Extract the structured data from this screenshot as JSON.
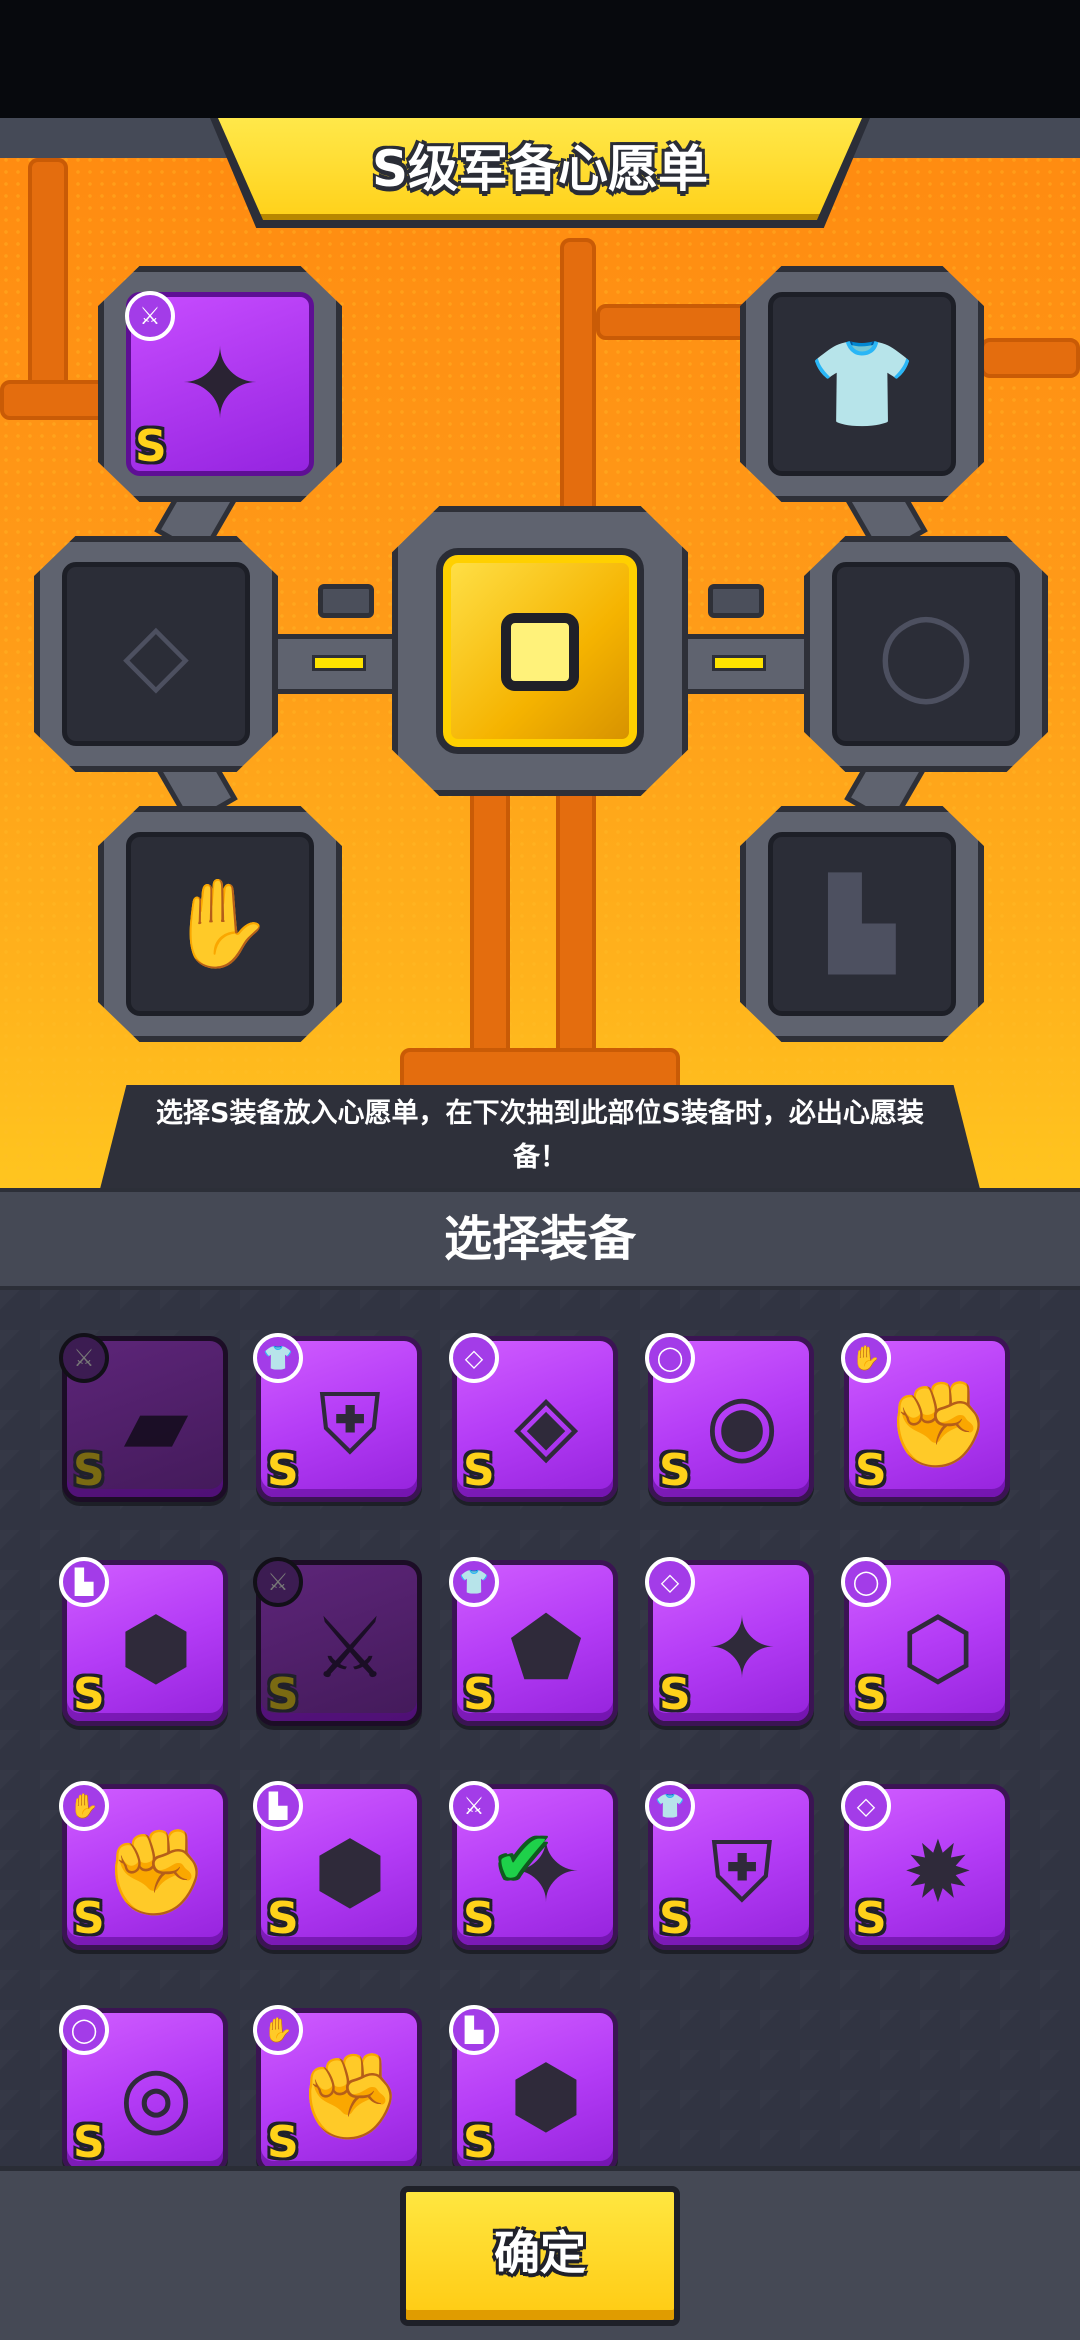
{
  "wishlist": {
    "title": "S级军备心愿单",
    "slots": [
      {
        "slot": "weapon",
        "icon": "dagger-icon",
        "state": "filled",
        "grade": "S"
      },
      {
        "slot": "armor",
        "icon": "shirt-icon",
        "state": "empty"
      },
      {
        "slot": "necklace",
        "icon": "necklace-icon",
        "state": "empty"
      },
      {
        "slot": "belt",
        "icon": "belt-icon",
        "state": "empty"
      },
      {
        "slot": "gloves",
        "icon": "glove-icon",
        "state": "empty"
      },
      {
        "slot": "boots",
        "icon": "boot-icon",
        "state": "empty"
      }
    ],
    "hint": "选择S装备放入心愿单，在下次抽到此部位S装备时，必出心愿装备！"
  },
  "selection": {
    "title": "选择装备",
    "items": [
      {
        "slot": "weapon",
        "grade": "S",
        "icon": "gun-icon",
        "dimmed": true,
        "selected": false
      },
      {
        "slot": "armor",
        "grade": "S",
        "icon": "chest-armor-icon",
        "dimmed": false,
        "selected": false
      },
      {
        "slot": "necklace",
        "grade": "S",
        "icon": "chain-necklace-icon",
        "dimmed": false,
        "selected": false
      },
      {
        "slot": "belt",
        "grade": "S",
        "icon": "ruby-belt-icon",
        "dimmed": false,
        "selected": false
      },
      {
        "slot": "gloves",
        "grade": "S",
        "icon": "gauntlet-icon",
        "dimmed": false,
        "selected": false
      },
      {
        "slot": "boots",
        "grade": "S",
        "icon": "spiked-boot-icon",
        "dimmed": false,
        "selected": false
      },
      {
        "slot": "weapon",
        "grade": "S",
        "icon": "blade-icon",
        "dimmed": true,
        "selected": false
      },
      {
        "slot": "armor",
        "grade": "S",
        "icon": "mech-armor-icon",
        "dimmed": false,
        "selected": false
      },
      {
        "slot": "necklace",
        "grade": "S",
        "icon": "star-necklace-icon",
        "dimmed": false,
        "selected": false
      },
      {
        "slot": "belt",
        "grade": "S",
        "icon": "gold-belt-icon",
        "dimmed": false,
        "selected": false
      },
      {
        "slot": "gloves",
        "grade": "S",
        "icon": "tech-glove-icon",
        "dimmed": false,
        "selected": false
      },
      {
        "slot": "boots",
        "grade": "S",
        "icon": "mech-boot-icon",
        "dimmed": false,
        "selected": false
      },
      {
        "slot": "weapon",
        "grade": "S",
        "icon": "orb-dagger-icon",
        "dimmed": false,
        "selected": true
      },
      {
        "slot": "armor",
        "grade": "S",
        "icon": "silver-armor-icon",
        "dimmed": false,
        "selected": false
      },
      {
        "slot": "necklace",
        "grade": "S",
        "icon": "orb-necklace-icon",
        "dimmed": false,
        "selected": false
      },
      {
        "slot": "belt",
        "grade": "S",
        "icon": "orb-belt-icon",
        "dimmed": false,
        "selected": false
      },
      {
        "slot": "gloves",
        "grade": "S",
        "icon": "silver-glove-icon",
        "dimmed": false,
        "selected": false
      },
      {
        "slot": "boots",
        "grade": "S",
        "icon": "silver-boot-icon",
        "dimmed": false,
        "selected": false
      }
    ]
  },
  "confirm_button": {
    "label": "确定"
  },
  "colors": {
    "accent": "#ffd21a",
    "item_bg": "#b43cf6",
    "panel": "#454955",
    "check": "#1ed14a"
  }
}
